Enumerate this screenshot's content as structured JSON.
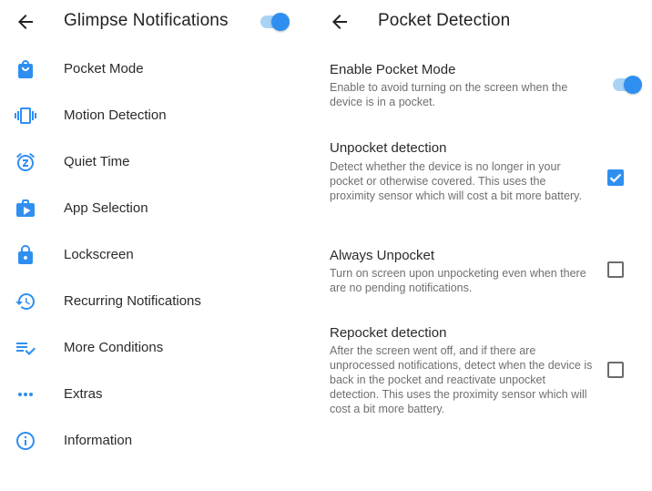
{
  "colors": {
    "accent": "#2f8ff0",
    "accent_track": "#a9d3f6",
    "text_primary": "#2a2a2a",
    "text_secondary": "#6f6f6f"
  },
  "left": {
    "title": "Glimpse Notifications",
    "master_switch_on": true,
    "menu": [
      {
        "label": "Pocket Mode",
        "icon": "shopping-bag-icon"
      },
      {
        "label": "Motion Detection",
        "icon": "vibration-icon"
      },
      {
        "label": "Quiet Time",
        "icon": "snooze-alarm-icon"
      },
      {
        "label": "App Selection",
        "icon": "app-store-bag-icon"
      },
      {
        "label": "Lockscreen",
        "icon": "lock-icon"
      },
      {
        "label": "Recurring Notifications",
        "icon": "history-icon"
      },
      {
        "label": "More Conditions",
        "icon": "playlist-check-icon"
      },
      {
        "label": "Extras",
        "icon": "more-horizontal-icon"
      },
      {
        "label": "Information",
        "icon": "info-icon"
      }
    ]
  },
  "right": {
    "title": "Pocket Detection",
    "settings": [
      {
        "title": "Enable Pocket Mode",
        "summary": "Enable to avoid turning on the screen when the device is in a pocket.",
        "control": "switch",
        "checked": true
      },
      {
        "title": "Unpocket detection",
        "summary": "Detect whether the device is no longer in your pocket or otherwise covered. This uses the proximity sensor which will cost a bit more battery.",
        "control": "checkbox",
        "checked": true
      },
      {
        "title": "Always Unpocket",
        "summary": "Turn on screen upon unpocketing even when there are no pending notifications.",
        "control": "checkbox",
        "checked": false
      },
      {
        "title": "Repocket detection",
        "summary": "After the screen went off, and if there are unprocessed notifications, detect when the device is back in the pocket and reactivate unpocket detection. This uses the proximity sensor which will cost a bit more battery.",
        "control": "checkbox",
        "checked": false
      }
    ]
  }
}
